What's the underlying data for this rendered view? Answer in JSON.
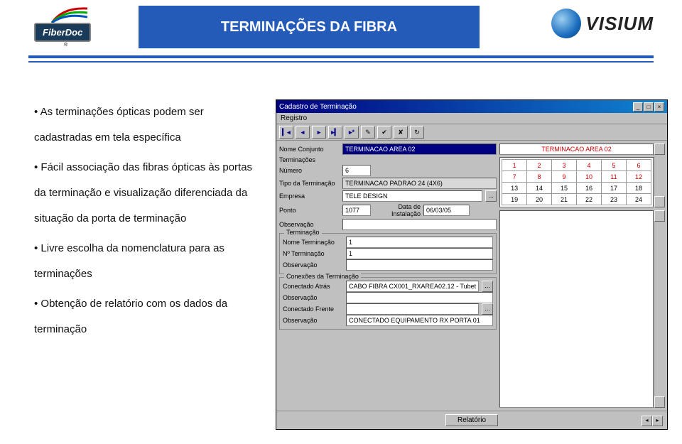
{
  "header": {
    "logo_left_text": "FiberDoc",
    "logo_left_reg": "®",
    "title": "TERMINAÇÕES DA FIBRA",
    "logo_right_text": "VISIUM"
  },
  "bullets": [
    "• As terminações ópticas podem ser cadastradas em tela específica",
    "• Fácil associação das fibras ópticas às portas da terminação e visualização diferenciada da situação da porta de terminação",
    "• Livre escolha da nomenclatura para as terminações",
    "• Obtenção de relatório com os dados da terminação"
  ],
  "window": {
    "title": "Cadastro de Terminação",
    "menu": "Registro",
    "toolbar": [
      "▎◂",
      "◂",
      "▸",
      "▸▎",
      "▸*",
      "✎",
      "✔",
      "✘",
      "↻"
    ],
    "form": {
      "nome_conjunto_lbl": "Nome Conjunto",
      "nome_conjunto_val": "TERMINACAO AREA 02",
      "terminacoes_lbl": "Terminações",
      "numero_lbl": "Número",
      "numero_val": "6",
      "tipo_lbl": "Tipo da Terminação",
      "tipo_val": "TERMINACAO PADRAO 24 (4X6)",
      "empresa_lbl": "Empresa",
      "empresa_val": "TELE DESIGN",
      "ponto_lbl": "Ponto",
      "ponto_val": "1077",
      "data_inst_lbl": "Data de Instalação",
      "data_inst_val": "06/03/05",
      "obs_lbl": "Observação",
      "grp_term": "Terminação",
      "nome_term_lbl": "Nome Terminação",
      "nome_term_val": "1",
      "num_term_lbl": "Nº Terminação",
      "num_term_val": "1",
      "grp_conex": "Conexões da Terminação",
      "con_atras_lbl": "Conectado Atrás",
      "con_atras_val": "CABO FIBRA CX001_RXAREA02.12 - Tubet",
      "con_frente_lbl": "Conectado Frente",
      "con_frente_val_lbl": "Observação",
      "con_frente_obs_val": "CONECTADO EQUIPAMENTO RX PORTA 01"
    },
    "right": {
      "header": "TERMINACAO AREA 02",
      "ports": [
        [
          "1",
          "2",
          "3",
          "4",
          "5",
          "6"
        ],
        [
          "7",
          "8",
          "9",
          "10",
          "11",
          "12"
        ],
        [
          "13",
          "14",
          "15",
          "16",
          "17",
          "18"
        ],
        [
          "19",
          "20",
          "21",
          "22",
          "23",
          "24"
        ]
      ]
    },
    "footer_btn": "Relatório"
  }
}
